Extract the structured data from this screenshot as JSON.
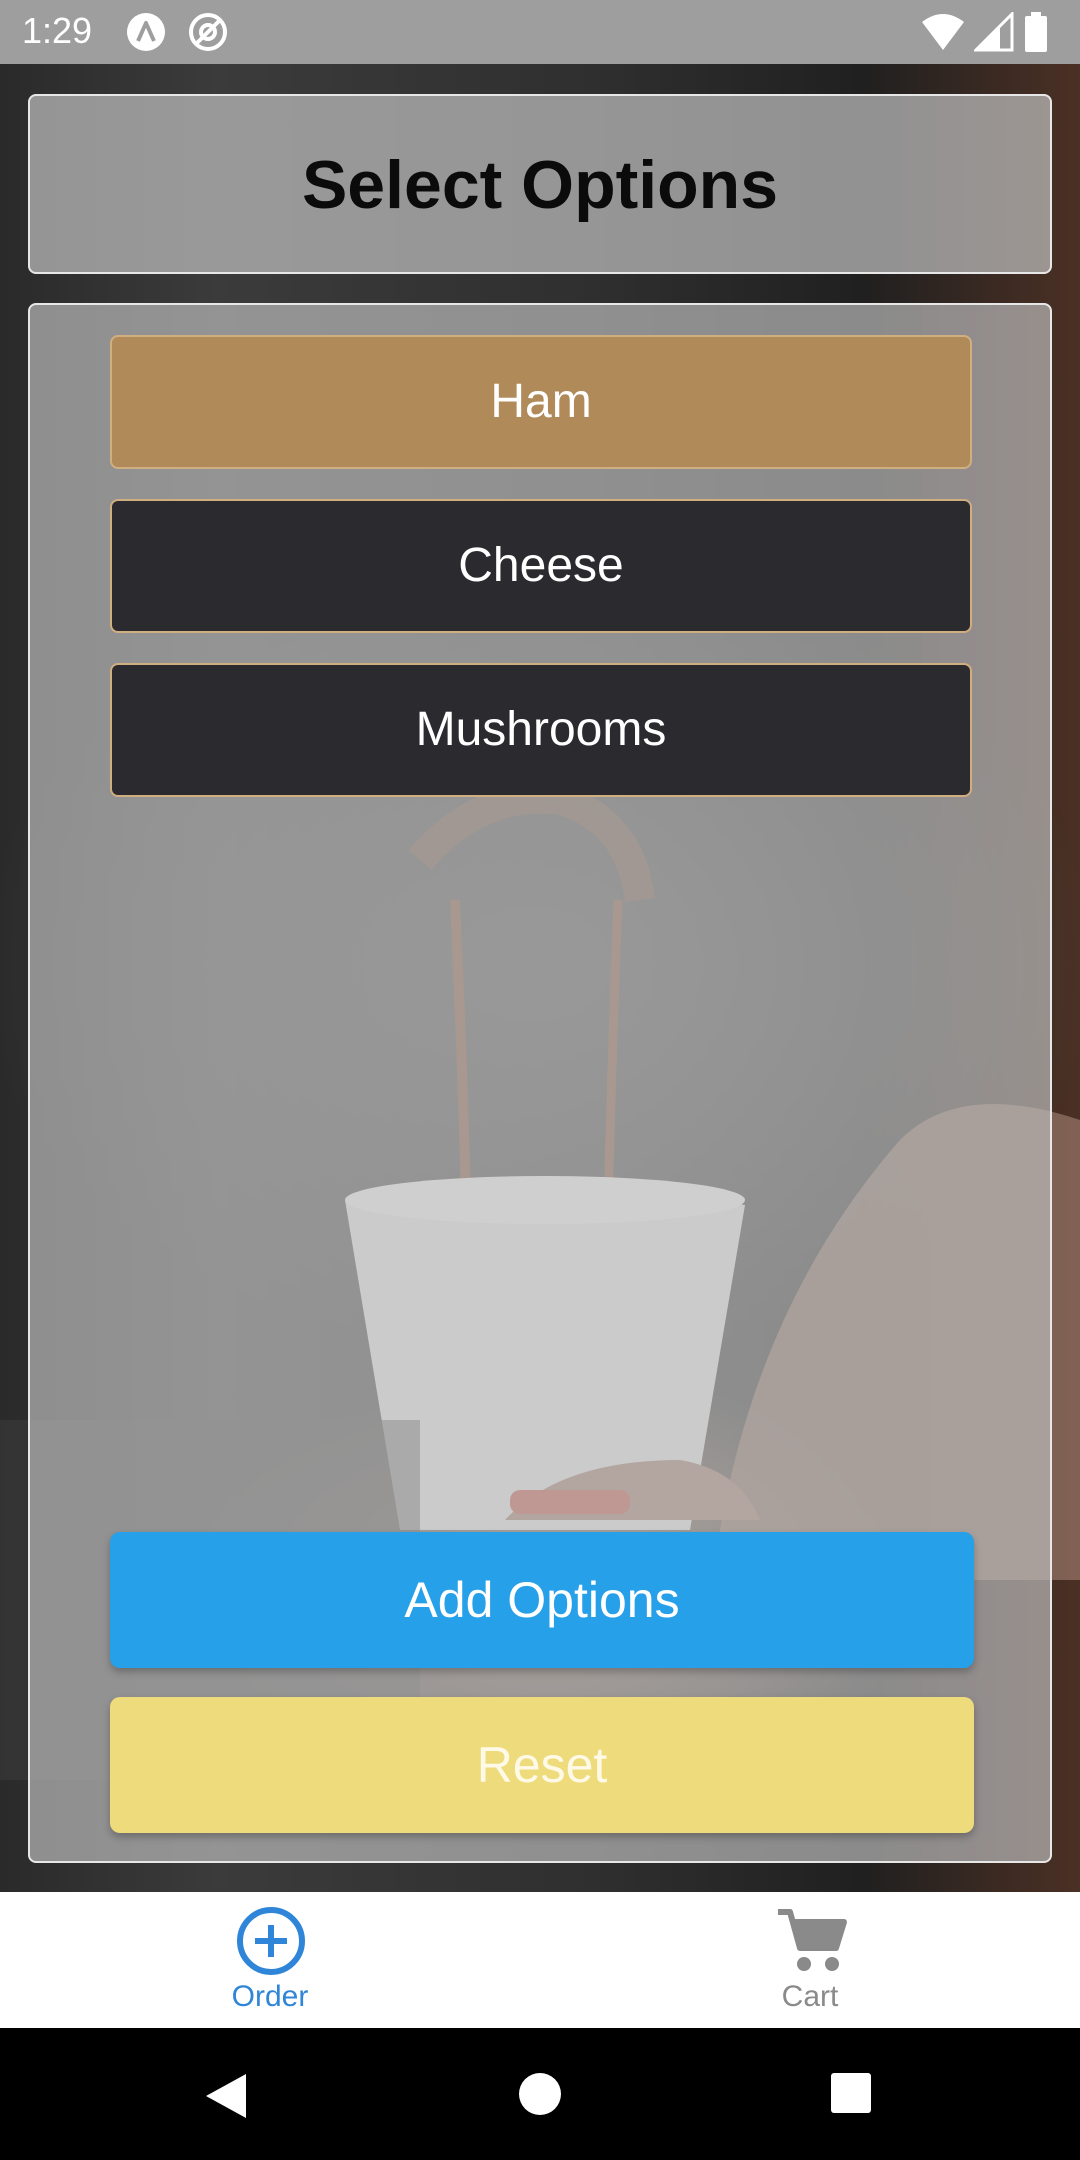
{
  "status_bar": {
    "time": "1:29",
    "icons": [
      "app-a-icon",
      "app-at-icon",
      "wifi-icon",
      "signal-icon",
      "battery-icon"
    ]
  },
  "header": {
    "title": "Select Options"
  },
  "options": [
    {
      "label": "Ham",
      "selected": true
    },
    {
      "label": "Cheese",
      "selected": false
    },
    {
      "label": "Mushrooms",
      "selected": false
    }
  ],
  "actions": {
    "add_label": "Add Options",
    "reset_label": "Reset"
  },
  "tab_bar": {
    "tabs": [
      {
        "label": "Order",
        "icon": "plus-circle-icon",
        "active": true
      },
      {
        "label": "Cart",
        "icon": "cart-icon",
        "active": false
      }
    ]
  },
  "nav_bar": {
    "icons": [
      "back-icon",
      "home-icon",
      "recents-icon"
    ]
  },
  "colors": {
    "selected_option": "#b08a58",
    "unselected_option": "#2b2a2f",
    "option_border": "#cfae80",
    "add_button": "#27a0ea",
    "reset_button": "#eedb7c",
    "active_tab": "#2f86d8",
    "inactive_tab": "#8a8a8a"
  }
}
